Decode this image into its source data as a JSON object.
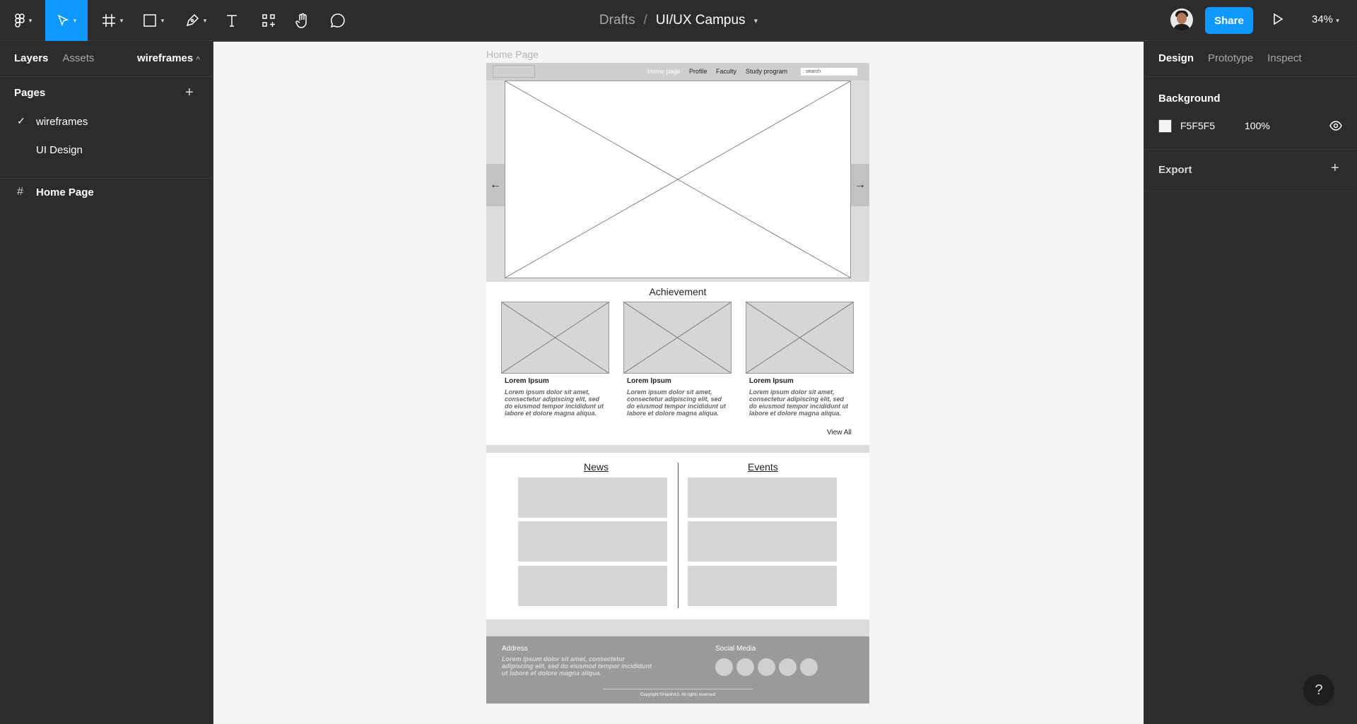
{
  "toolbar": {
    "tools": [
      "figma-menu-icon",
      "move-icon",
      "frame-icon",
      "shape-icon",
      "pen-icon",
      "text-icon",
      "components-icon",
      "hand-icon",
      "comment-icon"
    ],
    "accent": "#0d99ff",
    "breadcrumb_root": "Drafts",
    "breadcrumb_sep": "/",
    "file_name": "UI/UX Campus",
    "share_label": "Share",
    "zoom": "34%"
  },
  "left_panel": {
    "tab_layers": "Layers",
    "tab_assets": "Assets",
    "current_page": "wireframes",
    "pages_heading": "Pages",
    "pages": [
      {
        "label": "wireframes",
        "selected": true
      },
      {
        "label": "UI Design",
        "selected": false
      }
    ],
    "layers": [
      {
        "label": "Home Page",
        "icon": "frame-icon"
      }
    ]
  },
  "right_panel": {
    "tab_design": "Design",
    "tab_prototype": "Prototype",
    "tab_inspect": "Inspect",
    "background_heading": "Background",
    "background_hex": "F5F5F5",
    "background_color": "#f5f5f5",
    "background_opacity": "100%",
    "export_heading": "Export"
  },
  "help_label": "?",
  "frame": {
    "label": "Home Page",
    "nav": {
      "links": [
        "Home page",
        "Profile",
        "Faculty",
        "Study program"
      ],
      "search_placeholder": "search"
    },
    "hero": {
      "prev": "←",
      "next": "→"
    },
    "achievement": {
      "title": "Achievement",
      "cards": [
        {
          "title": "Lorem Ipsum",
          "text": "Lorem ipsum dolor sit amet, consectetur adipiscing elit, sed do eiusmod tempor incididunt ut labore et dolore magna aliqua."
        },
        {
          "title": "Lorem Ipsum",
          "text": "Lorem ipsum dolor sit amet, consectetur adipiscing elit, sed do eiusmod tempor incididunt ut labore et dolore magna aliqua."
        },
        {
          "title": "Lorem Ipsum",
          "text": "Lorem ipsum dolor sit amet, consectetur adipiscing elit, sed do eiusmod tempor incididunt ut labore et dolore magna aliqua."
        }
      ],
      "view_all": "View All"
    },
    "news_title": "News",
    "events_title": "Events",
    "footer": {
      "address_label": "Address",
      "address_text": "Lorem ipsum dolor sit amet, consectetur adipiscing elit, sed  do eiusmod tempor incididunt ut labore et dolore magna aliqua.",
      "social_label": "Social Media",
      "social_count": 5,
      "copyright": "Copyright ©HanimUI. All rights reserved"
    }
  }
}
